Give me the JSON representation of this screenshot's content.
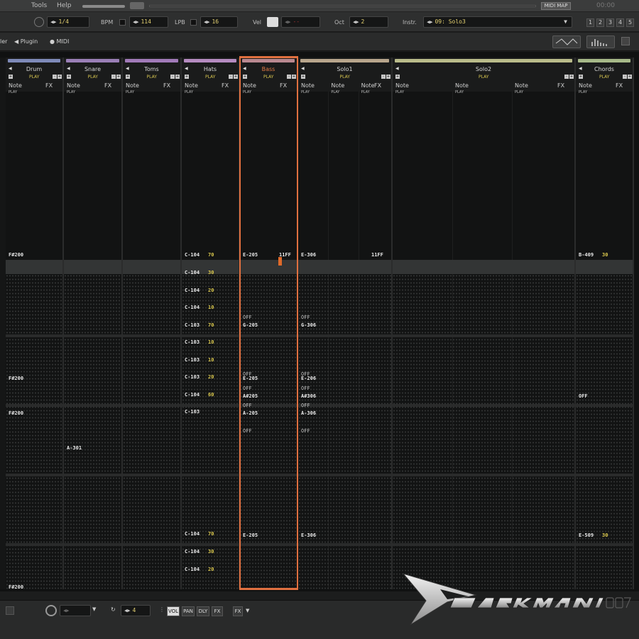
{
  "menu": {
    "tools": "Tools",
    "help": "Help",
    "midi_map": "MIDI MAP",
    "clock": "00:00"
  },
  "transport": {
    "edit_step": "1/4",
    "bpm_label": "BPM",
    "bpm": "114",
    "lpb_label": "LPB",
    "lpb": "16",
    "vel_label": "Vel",
    "vel": "--",
    "oct_label": "Oct",
    "oct": "2",
    "instr_label": "Instr.",
    "instr": "09: Solo3",
    "tabs": [
      "1",
      "2",
      "3",
      "4",
      "5"
    ]
  },
  "secondary": {
    "left": "ler",
    "plugin": "Plugin",
    "midi": "MIDI"
  },
  "play_label": "PLAY",
  "note_label": "Note",
  "fx_label": "FX",
  "tracks": [
    {
      "name": "Drum",
      "color": "#7e8ab8"
    },
    {
      "name": "Snare",
      "color": "#9a7fb6"
    },
    {
      "name": "Toms",
      "color": "#a17ab8"
    },
    {
      "name": "Hats",
      "color": "#b58bc0"
    },
    {
      "name": "Bass",
      "color": "#b88890",
      "selected": true
    },
    {
      "name": "Solo1",
      "color": "#b7a58c"
    },
    {
      "name": "Solo2",
      "color": "#b9bb8a"
    },
    {
      "name": "Chords",
      "color": "#a6b888"
    }
  ],
  "cells": {
    "drum": [
      "F#200",
      "F#200",
      "F#200",
      "F#200"
    ],
    "snare": [
      "A-301"
    ],
    "hats": [
      {
        "note": "C-104",
        "vol": "70"
      },
      {
        "note": "C-104",
        "vol": "30"
      },
      {
        "note": "C-104",
        "vol": "20"
      },
      {
        "note": "C-104",
        "vol": "10"
      },
      {
        "note": "C-103",
        "vol": "70"
      },
      {
        "note": "C-103",
        "vol": "10"
      },
      {
        "note": "C-103",
        "vol": "10"
      },
      {
        "note": "C-103",
        "vol": "20"
      },
      {
        "note": "C-104",
        "vol": "60"
      },
      {
        "note": "C-103",
        "vol": ""
      },
      {
        "note": "C-104",
        "vol": "70"
      },
      {
        "note": "C-104",
        "vol": "30"
      },
      {
        "note": "C-104",
        "vol": "20"
      }
    ],
    "bass": {
      "n1": "E-205",
      "fx1": "11FF",
      "off": "OFF",
      "n2": "G-205",
      "n3": "E-205",
      "n4": "A#205",
      "n5": "A-205",
      "n6": "E-205"
    },
    "solo1": {
      "n1": "E-306",
      "fx1": "11FF",
      "off": "OFF",
      "n2": "G-306",
      "n3": "E-206",
      "n4": "A#306",
      "n5": "A-306",
      "n6": "E-306"
    },
    "chords": {
      "n1": "B-409",
      "v1": "30",
      "off": "OFF",
      "n2": "E-509",
      "v2": "30"
    }
  },
  "bottom": {
    "value": "4",
    "buttons": [
      "VOL",
      "PAN",
      "DLY",
      "FX"
    ],
    "fx": "FX"
  },
  "colors": {
    "accent": "#e06a2a",
    "value": "#e3d070",
    "background": "#101111"
  }
}
